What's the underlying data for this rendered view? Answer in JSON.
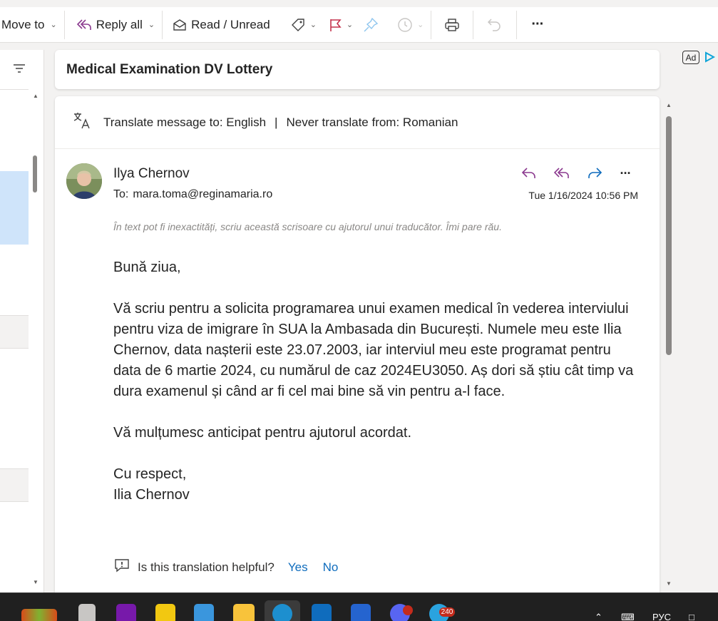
{
  "toolbar": {
    "move_to": "Move to",
    "reply_all": "Reply all",
    "read_unread": "Read / Unread",
    "more": "···"
  },
  "ad": {
    "badge": "Ad"
  },
  "message": {
    "subject": "Medical Examination DV Lottery",
    "translate_to_label": "Translate message to: English",
    "translate_separator": "|",
    "never_translate_label": "Never translate from: Romanian",
    "sender": "Ilya Chernov",
    "to_label": "To:",
    "to_address": "mara.toma@reginamaria.ro",
    "datetime": "Tue 1/16/2024 10:56 PM",
    "translator_note": "În text pot fi inexactități, scriu această scrisoare cu ajutorul unui traducător. Îmi pare rău.",
    "body": {
      "greeting": "Bună ziua,",
      "paragraph1": "Vă scriu pentru a solicita programarea unui examen medical în vederea interviului pentru viza de imigrare în SUA la Ambasada din București. Numele meu este Ilia Chernov, data nașterii este 23.07.2003, iar interviul meu este programat pentru data de 6 martie 2024, cu numărul de caz 2024EU3050. Aș dori să știu cât timp va dura examenul și când ar fi cel mai bine să vin pentru a-l face.",
      "paragraph2": "Vă mulțumesc anticipat pentru ajutorul acordat.",
      "closing": "Cu respect,",
      "signature": "Ilia Chernov"
    },
    "feedback": {
      "question": "Is this translation helpful?",
      "yes": "Yes",
      "no": "No"
    }
  },
  "taskbar": {
    "telegram_badge": "240",
    "language": "РУС"
  },
  "colors": {
    "accent_purple": "#8b3a8f",
    "accent_blue": "#0f6cbd",
    "flag_red": "#c4314b",
    "selected_row": "#cfe4fa"
  }
}
